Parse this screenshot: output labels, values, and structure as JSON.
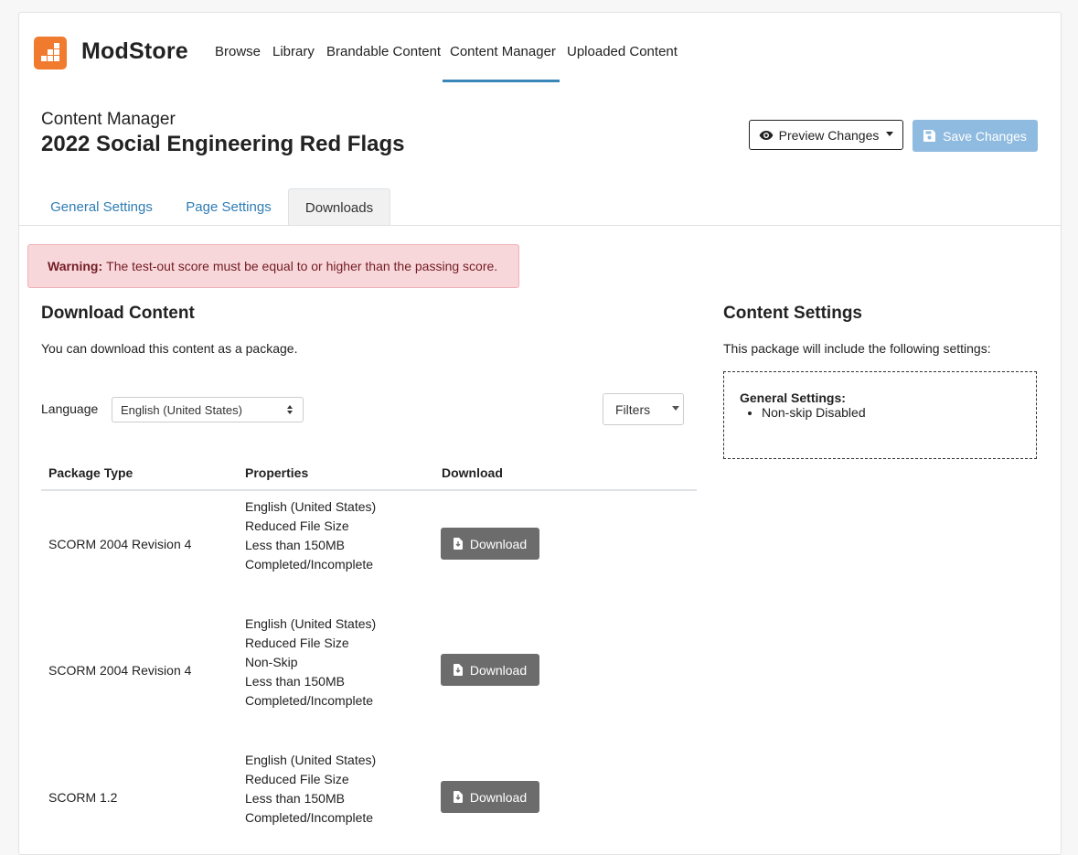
{
  "brand": {
    "name": "ModStore"
  },
  "nav": {
    "items": [
      {
        "label": "Browse"
      },
      {
        "label": "Library"
      },
      {
        "label": "Brandable Content"
      },
      {
        "label": "Content Manager"
      },
      {
        "label": "Uploaded Content"
      }
    ],
    "active": "Content Manager"
  },
  "header": {
    "breadcrumb": "Content Manager",
    "title": "2022 Social Engineering Red Flags",
    "preview_label": "Preview Changes",
    "save_label": "Save Changes"
  },
  "tabs": [
    {
      "label": "General Settings"
    },
    {
      "label": "Page Settings"
    },
    {
      "label": "Downloads"
    }
  ],
  "warning": {
    "strong": "Warning:",
    "text": "The test-out score must be equal to or higher than the passing score."
  },
  "download": {
    "heading": "Download Content",
    "description": "You can download this content as a package.",
    "language_label": "Language",
    "language_value": "English (United States)",
    "filters_label": "Filters",
    "columns": [
      "Package Type",
      "Properties",
      "Download"
    ],
    "rows": [
      {
        "type": "SCORM 2004 Revision 4",
        "properties": [
          "English (United States)",
          "Reduced File Size",
          "Less than 150MB",
          "Completed/Incomplete"
        ],
        "button": "Download"
      },
      {
        "type": "SCORM 2004 Revision 4",
        "properties": [
          "English (United States)",
          "Reduced File Size",
          "Non-Skip",
          "Less than 150MB",
          "Completed/Incomplete"
        ],
        "button": "Download"
      },
      {
        "type": "SCORM 1.2",
        "properties": [
          "English (United States)",
          "Reduced File Size",
          "Less than 150MB",
          "Completed/Incomplete"
        ],
        "button": "Download"
      }
    ]
  },
  "settings": {
    "heading": "Content Settings",
    "description": "This package will include the following settings:",
    "group_label": "General Settings:",
    "items": [
      "Non-skip Disabled"
    ]
  },
  "colors": {
    "brand_orange": "#f07a2e",
    "link_blue": "#2f7cb4",
    "save_button": "#8fbbe0",
    "warning_bg": "#f8d7da",
    "download_button": "#6c6c6c"
  }
}
